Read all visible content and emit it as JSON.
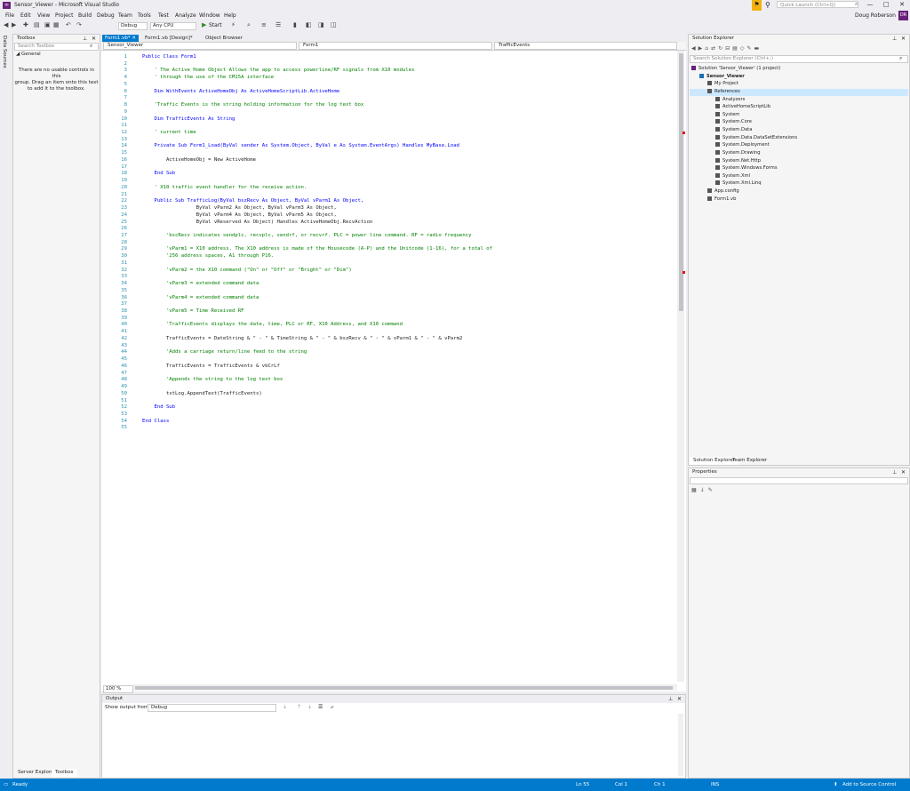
{
  "window": {
    "title": "Sensor_Viewer - Microsoft Visual Studio",
    "minimize": "—",
    "maximize": "□",
    "close": "✕"
  },
  "quick_launch": {
    "placeholder": "Quick Launch (Ctrl+Q)"
  },
  "account": {
    "user": "Doug Roberson",
    "initials": "DR"
  },
  "menu": [
    "File",
    "Edit",
    "View",
    "Project",
    "Build",
    "Debug",
    "Team",
    "Tools",
    "Test",
    "Analyze",
    "Window",
    "Help"
  ],
  "toolbar": {
    "configuration": "Debug",
    "platform": "Any CPU",
    "start_label": "Start"
  },
  "side_strip": {
    "data_sources": "Data Sources"
  },
  "toolbox": {
    "title": "Toolbox",
    "search_placeholder": "Search Toolbox",
    "group": "General",
    "empty_message": [
      "There are no usable controls in this",
      "group. Drag an item onto this text",
      "to add it to the toolbox."
    ],
    "tabs": [
      "Server Explorer",
      "Toolbox"
    ]
  },
  "doc_tabs": [
    {
      "label": "Form1.vb*",
      "active": true
    },
    {
      "label": "Form1.vb [Design]*",
      "active": false
    },
    {
      "label": "Object Browser",
      "active": false
    }
  ],
  "nav_bar": {
    "project": "Sensor_Viewer",
    "class": "Form1",
    "member": "TrafficEvents"
  },
  "code_lines": [
    {
      "n": "1",
      "t": "Public Class Form1"
    },
    {
      "n": "2",
      "t": ""
    },
    {
      "n": "3",
      "t": "    ' The Active Home Object Allows the app to access powerline/RF signals from X10 modules"
    },
    {
      "n": "4",
      "t": "    ' through the use of the CM15A interface"
    },
    {
      "n": "5",
      "t": ""
    },
    {
      "n": "6",
      "t": "    Dim WithEvents ActiveHomeObj As ActiveHomeScriptLib.ActiveHome"
    },
    {
      "n": "7",
      "t": ""
    },
    {
      "n": "8",
      "t": "    'Traffic Events is the string holding information for the log text box"
    },
    {
      "n": "9",
      "t": ""
    },
    {
      "n": "10",
      "t": "    Dim TrafficEvents As String"
    },
    {
      "n": "11",
      "t": ""
    },
    {
      "n": "12",
      "t": "    ' current time"
    },
    {
      "n": "13",
      "t": ""
    },
    {
      "n": "14",
      "t": "    Private Sub Form1_Load(ByVal sender As System.Object, ByVal e As System.EventArgs) Handles MyBase.Load"
    },
    {
      "n": "15",
      "t": ""
    },
    {
      "n": "16",
      "t": "        ActiveHomeObj = New ActiveHome"
    },
    {
      "n": "17",
      "t": ""
    },
    {
      "n": "18",
      "t": "    End Sub"
    },
    {
      "n": "19",
      "t": ""
    },
    {
      "n": "20",
      "t": "    ' X10 traffic event handler for the receive action."
    },
    {
      "n": "21",
      "t": ""
    },
    {
      "n": "22",
      "t": "    Public Sub TrafficLog(ByVal bszRecv As Object, ByVal vParm1 As Object,"
    },
    {
      "n": "23",
      "t": "                  ByVal vParm2 As Object, ByVal vParm3 As Object,"
    },
    {
      "n": "24",
      "t": "                  ByVal vParm4 As Object, ByVal vParm5 As Object,"
    },
    {
      "n": "25",
      "t": "                  ByVal vReserved As Object) Handles ActiveHomeObj.RecvAction"
    },
    {
      "n": "26",
      "t": ""
    },
    {
      "n": "27",
      "t": "        'bscRecv indicates sendplc, recvplc, sendrf, or recvrf. PLC = power line command. RF = radio frequency"
    },
    {
      "n": "28",
      "t": ""
    },
    {
      "n": "29",
      "t": "        'vParm1 = X10 address. The X10 address is made of the Housecode (A-P) and the Unitcode (1-16), for a total of"
    },
    {
      "n": "30",
      "t": "        '256 address spaces, A1 through P16."
    },
    {
      "n": "31",
      "t": ""
    },
    {
      "n": "32",
      "t": "        'vParm2 = the X10 command (\"On\" or \"Off\" or \"Bright\" or \"Dim\")"
    },
    {
      "n": "33",
      "t": ""
    },
    {
      "n": "34",
      "t": "        'vParm3 = extended command data"
    },
    {
      "n": "35",
      "t": ""
    },
    {
      "n": "36",
      "t": "        'vParm4 = extended command data"
    },
    {
      "n": "37",
      "t": ""
    },
    {
      "n": "38",
      "t": "        'vParm5 = Time Received RF"
    },
    {
      "n": "39",
      "t": ""
    },
    {
      "n": "40",
      "t": "        'TrafficEvents displays the date, time, PLC or RF, X10 Address, and X10 command"
    },
    {
      "n": "41",
      "t": ""
    },
    {
      "n": "42",
      "t": "        TrafficEvents = DateString & \" - \" & TimeString & \" - \" & bszRecv & \" - \" & vParm1 & \" - \" & vParm2"
    },
    {
      "n": "43",
      "t": ""
    },
    {
      "n": "44",
      "t": "        'Adds a carriage return/line feed to the string"
    },
    {
      "n": "45",
      "t": ""
    },
    {
      "n": "46",
      "t": "        TrafficEvents = TrafficEvents & vbCrLf"
    },
    {
      "n": "47",
      "t": ""
    },
    {
      "n": "48",
      "t": "        'Appends the string to the log text box"
    },
    {
      "n": "49",
      "t": ""
    },
    {
      "n": "50",
      "t": "        txtLog.AppendText(TrafficEvents)"
    },
    {
      "n": "51",
      "t": ""
    },
    {
      "n": "52",
      "t": "    End Sub"
    },
    {
      "n": "53",
      "t": ""
    },
    {
      "n": "54",
      "t": "End Class"
    },
    {
      "n": "55",
      "t": ""
    }
  ],
  "zoom": "100 %",
  "output": {
    "title": "Output",
    "show_from_label": "Show output from:",
    "source": "Debug"
  },
  "solution_explorer": {
    "title": "Solution Explorer",
    "search_placeholder": "Search Solution Explorer (Ctrl+;)",
    "tree": [
      {
        "label": "Solution 'Sensor_Viewer' (1 project)",
        "level": 0,
        "bold": false
      },
      {
        "label": "Sensor_Viewer",
        "level": 1,
        "bold": true
      },
      {
        "label": "My Project",
        "level": 2,
        "bold": false
      },
      {
        "label": "References",
        "level": 2,
        "bold": false
      },
      {
        "label": "Analyzers",
        "level": 3,
        "bold": false
      },
      {
        "label": "ActiveHomeScriptLib",
        "level": 3,
        "bold": false
      },
      {
        "label": "System",
        "level": 3,
        "bold": false
      },
      {
        "label": "System.Core",
        "level": 3,
        "bold": false
      },
      {
        "label": "System.Data",
        "level": 3,
        "bold": false
      },
      {
        "label": "System.Data.DataSetExtensions",
        "level": 3,
        "bold": false
      },
      {
        "label": "System.Deployment",
        "level": 3,
        "bold": false
      },
      {
        "label": "System.Drawing",
        "level": 3,
        "bold": false
      },
      {
        "label": "System.Net.Http",
        "level": 3,
        "bold": false
      },
      {
        "label": "System.Windows.Forms",
        "level": 3,
        "bold": false
      },
      {
        "label": "System.Xml",
        "level": 3,
        "bold": false
      },
      {
        "label": "System.Xml.Linq",
        "level": 3,
        "bold": false
      },
      {
        "label": "App.config",
        "level": 2,
        "bold": false
      },
      {
        "label": "Form1.vb",
        "level": 2,
        "bold": false
      }
    ],
    "tabs": [
      "Solution Explorer",
      "Team Explorer"
    ]
  },
  "properties": {
    "title": "Properties"
  },
  "status_bar": {
    "ready": "Ready",
    "line": "Ln 55",
    "col": "Col 1",
    "ch": "Ch 1",
    "mode": "INS",
    "source_control": "Add to Source Control"
  },
  "colors": {
    "accent": "#007acc",
    "brand": "#68217a",
    "keyword": "#0000ff",
    "comment": "#008000",
    "type": "#2b91af"
  }
}
